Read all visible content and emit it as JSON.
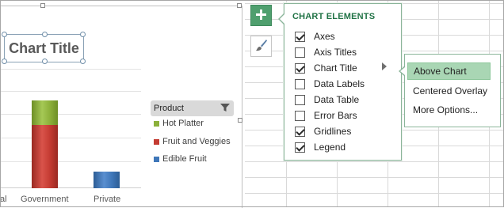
{
  "chart": {
    "title": "Chart Title",
    "categories": [
      "al",
      "Government",
      "Private"
    ],
    "legend": {
      "header": "Product",
      "items": [
        {
          "label": "Hot Platter",
          "color": "#8cb03a"
        },
        {
          "label": "Fruit and Veggies",
          "color": "#c43b32"
        },
        {
          "label": "Edible Fruit",
          "color": "#3f77b9"
        }
      ]
    }
  },
  "panel": {
    "heading": "CHART ELEMENTS",
    "items": [
      {
        "label": "Axes",
        "checked": true
      },
      {
        "label": "Axis Titles",
        "checked": false
      },
      {
        "label": "Chart Title",
        "checked": true
      },
      {
        "label": "Data Labels",
        "checked": false
      },
      {
        "label": "Data Table",
        "checked": false
      },
      {
        "label": "Error Bars",
        "checked": false
      },
      {
        "label": "Gridlines",
        "checked": true
      },
      {
        "label": "Legend",
        "checked": true
      }
    ]
  },
  "submenu": {
    "items": [
      {
        "label": "Above Chart",
        "active": true
      },
      {
        "label": "Centered Overlay",
        "active": false
      },
      {
        "label": "More Options...",
        "active": false
      }
    ]
  },
  "icons": {
    "add_elements": "plus-icon",
    "chart_styles": "paintbrush-icon",
    "legend_filter": "filter-icon"
  }
}
